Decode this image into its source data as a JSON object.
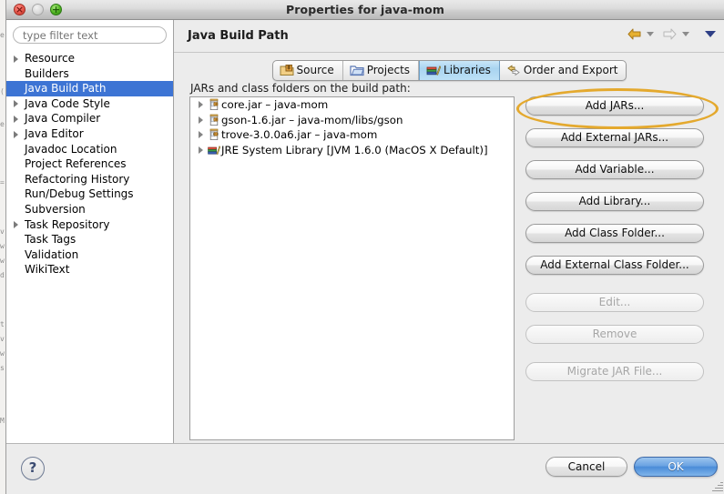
{
  "window": {
    "title": "Properties for java-mom",
    "traffic_lights": [
      {
        "name": "close",
        "glyph": "×",
        "enabled": true
      },
      {
        "name": "minimize",
        "glyph": "",
        "enabled": false
      },
      {
        "name": "zoom",
        "glyph": "+",
        "enabled": true
      }
    ]
  },
  "sidebar": {
    "filter": {
      "value": "",
      "placeholder": "type filter text"
    },
    "items": [
      {
        "label": "Resource",
        "expandable": true,
        "selected": false
      },
      {
        "label": "Builders",
        "expandable": false,
        "selected": false
      },
      {
        "label": "Java Build Path",
        "expandable": false,
        "selected": true
      },
      {
        "label": "Java Code Style",
        "expandable": true,
        "selected": false
      },
      {
        "label": "Java Compiler",
        "expandable": true,
        "selected": false
      },
      {
        "label": "Java Editor",
        "expandable": true,
        "selected": false
      },
      {
        "label": "Javadoc Location",
        "expandable": false,
        "selected": false
      },
      {
        "label": "Project References",
        "expandable": false,
        "selected": false
      },
      {
        "label": "Refactoring History",
        "expandable": false,
        "selected": false
      },
      {
        "label": "Run/Debug Settings",
        "expandable": false,
        "selected": false
      },
      {
        "label": "Subversion",
        "expandable": false,
        "selected": false
      },
      {
        "label": "Task Repository",
        "expandable": true,
        "selected": false
      },
      {
        "label": "Task Tags",
        "expandable": false,
        "selected": false
      },
      {
        "label": "Validation",
        "expandable": false,
        "selected": false
      },
      {
        "label": "WikiText",
        "expandable": false,
        "selected": false
      }
    ]
  },
  "page": {
    "title": "Java Build Path",
    "nav": {
      "back_icon": "back-arrow-icon",
      "back_enabled": true,
      "forward_icon": "forward-arrow-icon",
      "forward_enabled": false,
      "menu_icon": "chevron-down-icon"
    }
  },
  "tabs": [
    {
      "label": "Source",
      "icon": "source-folder-icon",
      "active": false
    },
    {
      "label": "Projects",
      "icon": "project-folder-icon",
      "active": false
    },
    {
      "label": "Libraries",
      "icon": "library-books-icon",
      "active": true
    },
    {
      "label": "Order and Export",
      "icon": "order-export-icon",
      "active": false
    }
  ],
  "libraries": {
    "list_label": "JARs and class folders on the build path:",
    "entries": [
      {
        "label": "core.jar – java-mom",
        "icon": "jar-icon",
        "expandable": true
      },
      {
        "label": "gson-1.6.jar – java-mom/libs/gson",
        "icon": "jar-icon",
        "expandable": true
      },
      {
        "label": "trove-3.0.0a6.jar – java-mom",
        "icon": "jar-binary-icon",
        "expandable": true
      },
      {
        "label": "JRE System Library [JVM 1.6.0 (MacOS X Default)]",
        "icon": "jre-library-icon",
        "expandable": true
      }
    ]
  },
  "buttons": {
    "add_jars": {
      "label": "Add JARs...",
      "enabled": true,
      "highlighted": true
    },
    "add_external_jars": {
      "label": "Add External JARs...",
      "enabled": true
    },
    "add_variable": {
      "label": "Add Variable...",
      "enabled": true
    },
    "add_library": {
      "label": "Add Library...",
      "enabled": true
    },
    "add_class_folder": {
      "label": "Add Class Folder...",
      "enabled": true
    },
    "add_external_class_folder": {
      "label": "Add External Class Folder...",
      "enabled": true
    },
    "edit": {
      "label": "Edit...",
      "enabled": false
    },
    "remove": {
      "label": "Remove",
      "enabled": false
    },
    "migrate_jar_file": {
      "label": "Migrate JAR File...",
      "enabled": false
    }
  },
  "footer": {
    "help_icon": "help-question-icon",
    "help_label": "?",
    "cancel_label": "Cancel",
    "ok_label": "OK"
  },
  "annotation": {
    "shape": "ellipse",
    "color": "#e4a92e",
    "target": "Add JARs..."
  },
  "colors": {
    "selection_blue": "#3d74d4",
    "active_tab_blue": "#a9d4f0",
    "ok_button_blue": "#4a8cd8",
    "annotation_gold": "#e4a92e",
    "window_chrome": "#ececec"
  }
}
